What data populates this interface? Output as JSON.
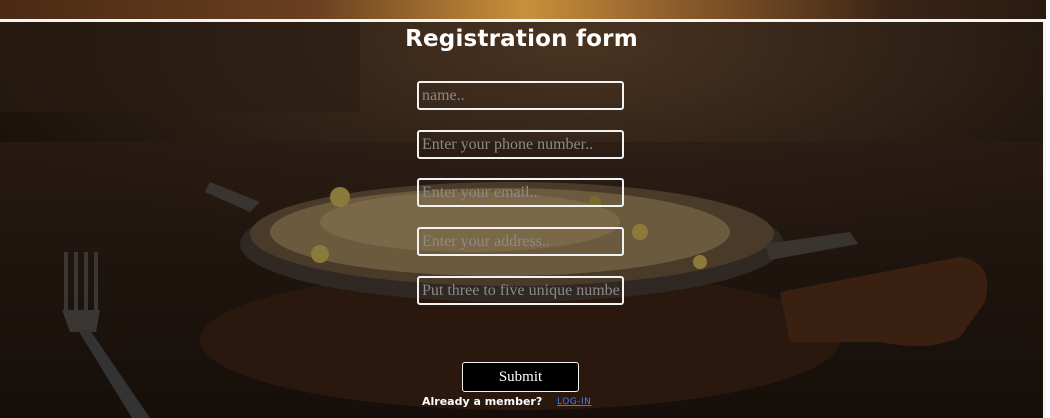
{
  "form": {
    "title": "Registration form",
    "fields": {
      "name": {
        "placeholder": "name..",
        "value": ""
      },
      "phone": {
        "placeholder": "Enter your phone number..",
        "value": ""
      },
      "email": {
        "placeholder": "Enter your email..",
        "value": ""
      },
      "address": {
        "placeholder": "Enter your address..",
        "value": ""
      },
      "unique_numbers": {
        "placeholder": "Put three to five unique numbers",
        "value": ""
      }
    },
    "submit_label": "Submit",
    "member_prompt": "Already a member?",
    "login_label": "LOG-IN"
  },
  "colors": {
    "overlay": "#1a120c",
    "field_border": "#f2f2f2",
    "link": "#3b7cff",
    "button_bg": "#000000"
  }
}
